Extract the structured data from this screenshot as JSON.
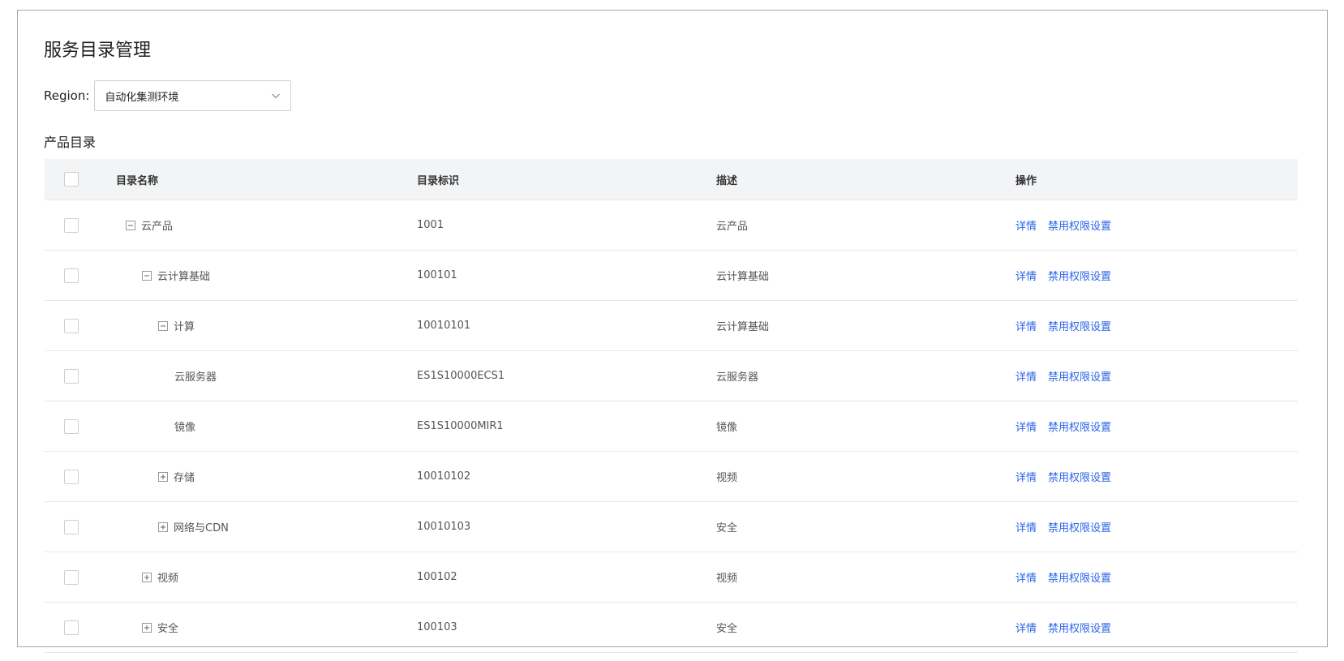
{
  "page_title": "服务目录管理",
  "region": {
    "label": "Region:",
    "selected": "自动化集测环境"
  },
  "section_label": "产品目录",
  "table": {
    "headers": {
      "name": "目录名称",
      "id": "目录标识",
      "desc": "描述",
      "ops": "操作"
    },
    "rows": [
      {
        "name": "云产品",
        "level": 0,
        "toggle": "collapse",
        "id": "1001",
        "desc": "云产品",
        "op_detail": "详情",
        "op_perm": "禁用权限设置"
      },
      {
        "name": "云计算基础",
        "level": 1,
        "toggle": "collapse",
        "id": "100101",
        "desc": "云计算基础",
        "op_detail": "详情",
        "op_perm": "禁用权限设置"
      },
      {
        "name": "计算",
        "level": 2,
        "toggle": "collapse",
        "id": "10010101",
        "desc": "云计算基础",
        "op_detail": "详情",
        "op_perm": "禁用权限设置"
      },
      {
        "name": "云服务器",
        "level": 3,
        "toggle": "none",
        "id": "ES1S10000ECS1",
        "desc": "云服务器",
        "op_detail": "详情",
        "op_perm": "禁用权限设置"
      },
      {
        "name": "镜像",
        "level": 3,
        "toggle": "none",
        "id": "ES1S10000MIR1",
        "desc": "镜像",
        "op_detail": "详情",
        "op_perm": "禁用权限设置"
      },
      {
        "name": "存储",
        "level": 2,
        "toggle": "expand",
        "id": "10010102",
        "desc": "视频",
        "op_detail": "详情",
        "op_perm": "禁用权限设置"
      },
      {
        "name": "网络与CDN",
        "level": 2,
        "toggle": "expand",
        "id": "10010103",
        "desc": "安全",
        "op_detail": "详情",
        "op_perm": "禁用权限设置"
      },
      {
        "name": "视频",
        "level": 1,
        "toggle": "expand",
        "id": "100102",
        "desc": "视频",
        "op_detail": "详情",
        "op_perm": "禁用权限设置"
      },
      {
        "name": "安全",
        "level": 1,
        "toggle": "expand",
        "id": "100103",
        "desc": "安全",
        "op_detail": "详情",
        "op_perm": "禁用权限设置"
      }
    ]
  },
  "colors": {
    "link": "#2b64e8",
    "header_bg": "#f3f4f6",
    "border": "#e8e8e8"
  }
}
